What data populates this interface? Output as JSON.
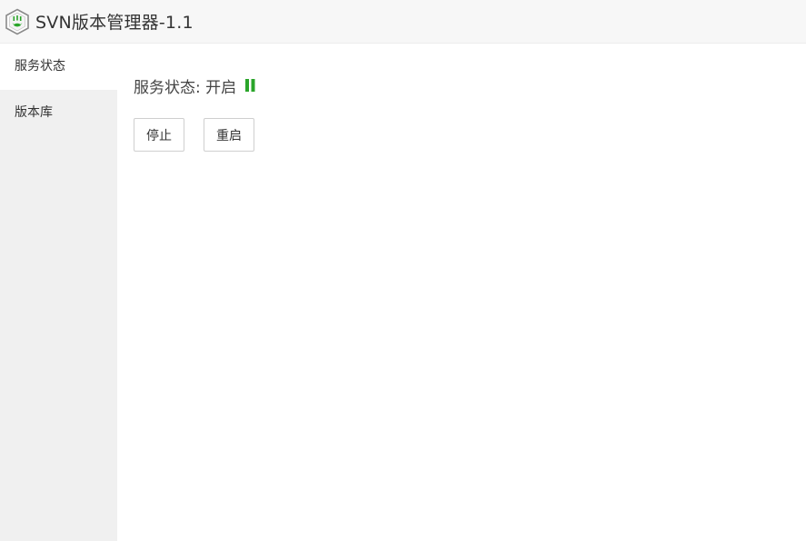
{
  "header": {
    "title": "SVN版本管理器-1.1",
    "logo_icon": "svn-shield-logo-icon"
  },
  "sidebar": {
    "items": [
      {
        "label": "服务状态",
        "active": true
      },
      {
        "label": "版本库",
        "active": false
      }
    ]
  },
  "main": {
    "status_label": "服务状态: 开启",
    "status_icon": "pause-icon",
    "status_color": "#2aa52a",
    "buttons": {
      "stop_label": "停止",
      "restart_label": "重启"
    }
  },
  "colors": {
    "header_bg": "#f7f7f7",
    "sidebar_bg": "#f0f0f0",
    "accent_green": "#2aa52a"
  }
}
